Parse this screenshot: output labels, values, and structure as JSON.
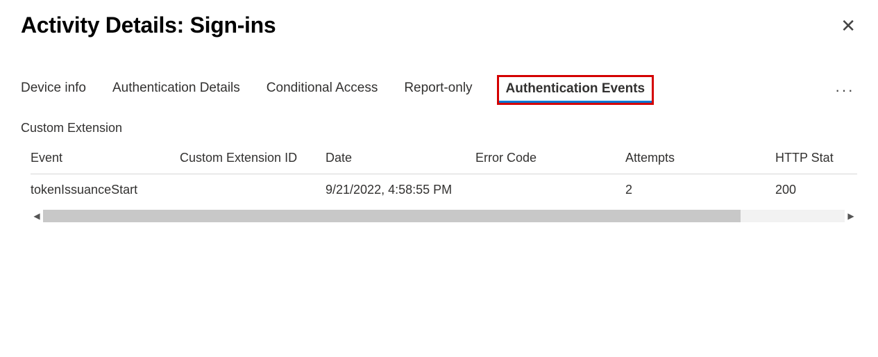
{
  "header": {
    "title": "Activity Details: Sign-ins"
  },
  "tabs": [
    {
      "label": "Device info",
      "active": false
    },
    {
      "label": "Authentication Details",
      "active": false
    },
    {
      "label": "Conditional Access",
      "active": false
    },
    {
      "label": "Report-only",
      "active": false
    },
    {
      "label": "Authentication Events",
      "active": true,
      "highlighted": true
    }
  ],
  "section": {
    "label": "Custom Extension",
    "columns": [
      "Event",
      "Custom Extension ID",
      "Date",
      "Error Code",
      "Attempts",
      "HTTP Stat"
    ],
    "rows": [
      {
        "event": "tokenIssuanceStart",
        "custom_extension_id": "",
        "date": "9/21/2022, 4:58:55 PM",
        "error_code": "",
        "attempts": "2",
        "http_stat": "200"
      }
    ]
  }
}
